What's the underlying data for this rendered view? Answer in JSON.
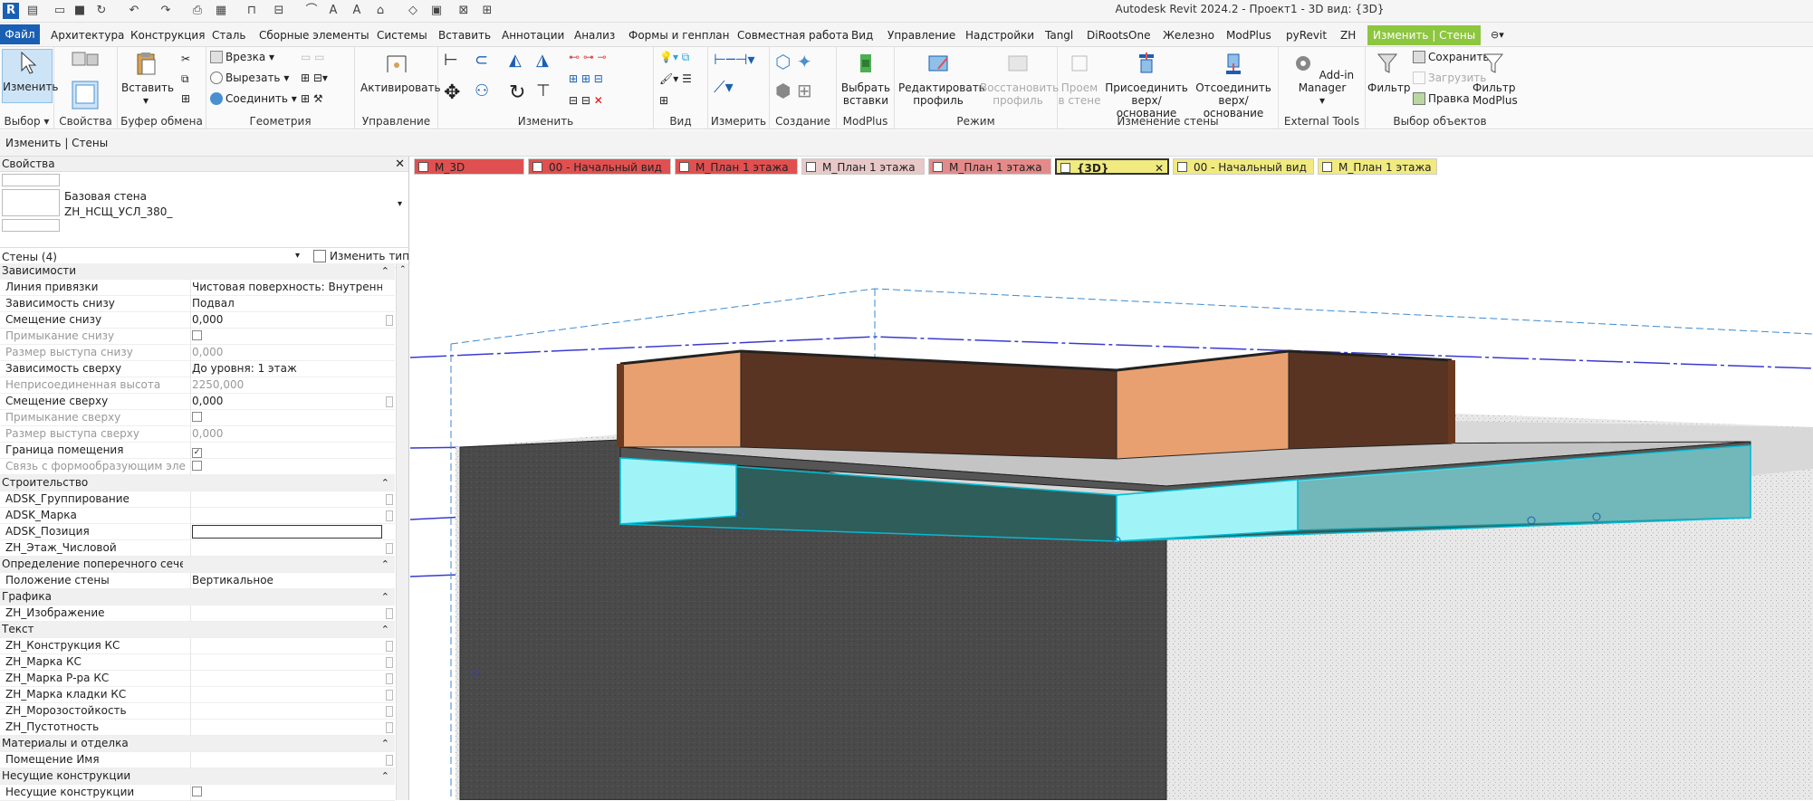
{
  "app": {
    "logo": "R",
    "title": "Autodesk Revit 2024.2 - Проект1 - 3D вид: {3D}"
  },
  "ribbon_tabs": [
    "Файл",
    "Архитектура",
    "Конструкция",
    "Сталь",
    "Сборные элементы",
    "Системы",
    "Вставить",
    "Аннотации",
    "Анализ",
    "Формы и генплан",
    "Совместная работа",
    "Вид",
    "Управление",
    "Надстройки",
    "Tangl",
    "DiRootsOne",
    "Железно",
    "ModPlus",
    "pyRevit",
    "ZH",
    "Изменить | Стены"
  ],
  "ribbon": {
    "select_panel": {
      "modify": "Изменить",
      "label": "Выбор"
    },
    "properties_panel": {
      "label": "Свойства"
    },
    "clipboard_panel": {
      "paste": "Вставить",
      "label": "Буфер обмена"
    },
    "geometry_panel": {
      "cope": "Врезка",
      "cut": "Вырезать",
      "join": "Соединить",
      "label": "Геометрия"
    },
    "control_panel": {
      "activate": "Активировать",
      "label": "Управление"
    },
    "modify_panel": {
      "label": "Изменить"
    },
    "view_panel": {
      "label": "Вид"
    },
    "measure_panel": {
      "label": "Измерить"
    },
    "create_panel": {
      "label": "Создание"
    },
    "modplus_panel": {
      "select_inserts_l1": "Выбрать",
      "select_inserts_l2": "вставки",
      "label": "ModPlus"
    },
    "mode_panel": {
      "edit_profile_l1": "Редактировать",
      "edit_profile_l2": "профиль",
      "reset_profile_l1": "Восстановить",
      "reset_profile_l2": "профиль",
      "label": "Режим"
    },
    "wall_panel": {
      "opening_l1": "Проем",
      "opening_l2": "в стене",
      "attach_l1": "Присоединить",
      "attach_l2": "верх/основание",
      "detach_l1": "Отсоединить",
      "detach_l2": "верх/основание",
      "label": "Изменение стены"
    },
    "external_panel": {
      "addin": "Add-in Manager",
      "label": "External Tools"
    },
    "filter_panel": {
      "filter": "Фильтр",
      "save": "Сохранить",
      "load": "Загрузить",
      "edit": "Правка",
      "modplus_filter_l1": "Фильтр",
      "modplus_filter_l2": "ModPlus",
      "label": "Выбор объектов"
    }
  },
  "options_bar": {
    "text": "Изменить | Стены"
  },
  "properties": {
    "header": "Свойства",
    "type_line1": "Базовая стена",
    "type_line2": "ZH_НСЩ_УСЛ_380_",
    "selection": "Стены (4)",
    "edit_type": "Изменить тип",
    "rows": [
      {
        "k": "Зависимости",
        "section": true
      },
      {
        "k": "Линия привязки",
        "v": "Чистовая поверхность: Внутренняя"
      },
      {
        "k": "Зависимость снизу",
        "v": "Подвал"
      },
      {
        "k": "Смещение снизу",
        "v": "0,000",
        "btn": true
      },
      {
        "k": "Примыкание снизу",
        "cb": "off",
        "gray": true
      },
      {
        "k": "Размер выступа снизу",
        "v": "0,000",
        "gray": true
      },
      {
        "k": "Зависимость сверху",
        "v": "До уровня: 1 этаж"
      },
      {
        "k": "Неприсоединенная высота",
        "v": "2250,000",
        "gray": true
      },
      {
        "k": "Смещение сверху",
        "v": "0,000",
        "btn": true
      },
      {
        "k": "Примыкание сверху",
        "cb": "off",
        "gray": true
      },
      {
        "k": "Размер выступа сверху",
        "v": "0,000",
        "gray": true
      },
      {
        "k": "Граница помещения",
        "cb": "on"
      },
      {
        "k": "Связь с формообразующим элем...",
        "cb": "off",
        "gray": true
      },
      {
        "k": "Строительство",
        "section": true
      },
      {
        "k": "ADSK_Группирование",
        "v": "",
        "btn": true
      },
      {
        "k": "ADSK_Марка",
        "v": "",
        "btn": true
      },
      {
        "k": "ADSK_Позиция",
        "v": "",
        "box": true
      },
      {
        "k": "ZH_Этаж_Числовой",
        "v": "",
        "btn": true
      },
      {
        "k": "Определение поперечного сечения",
        "section": true
      },
      {
        "k": "Положение стены",
        "v": "Вертикальное"
      },
      {
        "k": "Графика",
        "section": true
      },
      {
        "k": "ZH_Изображение",
        "v": "",
        "btn": true
      },
      {
        "k": "Текст",
        "section": true
      },
      {
        "k": "ZH_Конструкция КС",
        "v": "",
        "btn": true
      },
      {
        "k": "ZH_Марка КС",
        "v": "",
        "btn": true
      },
      {
        "k": "ZH_Марка Р-ра КС",
        "v": "",
        "btn": true
      },
      {
        "k": "ZH_Марка кладки КС",
        "v": "",
        "btn": true
      },
      {
        "k": "ZH_Морозостойкость",
        "v": "",
        "btn": true
      },
      {
        "k": "ZH_Пустотность",
        "v": "",
        "btn": true
      },
      {
        "k": "Материалы и отделка",
        "section": true
      },
      {
        "k": "Помещение Имя",
        "v": "",
        "btn": true
      },
      {
        "k": "Несущие конструкции",
        "section": true
      },
      {
        "k": "Несущие конструкции",
        "cb": "off"
      }
    ]
  },
  "view_tabs": [
    {
      "label": "M_3D",
      "color": "#e05050"
    },
    {
      "label": "00 - Начальный вид",
      "color": "#e05050"
    },
    {
      "label": "М_План 1 этажа",
      "color": "#e05050"
    },
    {
      "label": "М_План 1 этажа",
      "color": "#e8c8c8"
    },
    {
      "label": "М_План 1 этажа",
      "color": "#e58a8a"
    },
    {
      "label": "{3D}",
      "color": "#f0ea80",
      "active": true
    },
    {
      "label": "00 - Начальный вид",
      "color": "#f0ea80"
    },
    {
      "label": "М_План 1 этажа",
      "color": "#f0ea80"
    }
  ],
  "colors": {
    "accent": "#1a5fb4",
    "context_tab": "#8dc63f",
    "selection": "#00bcd4"
  }
}
